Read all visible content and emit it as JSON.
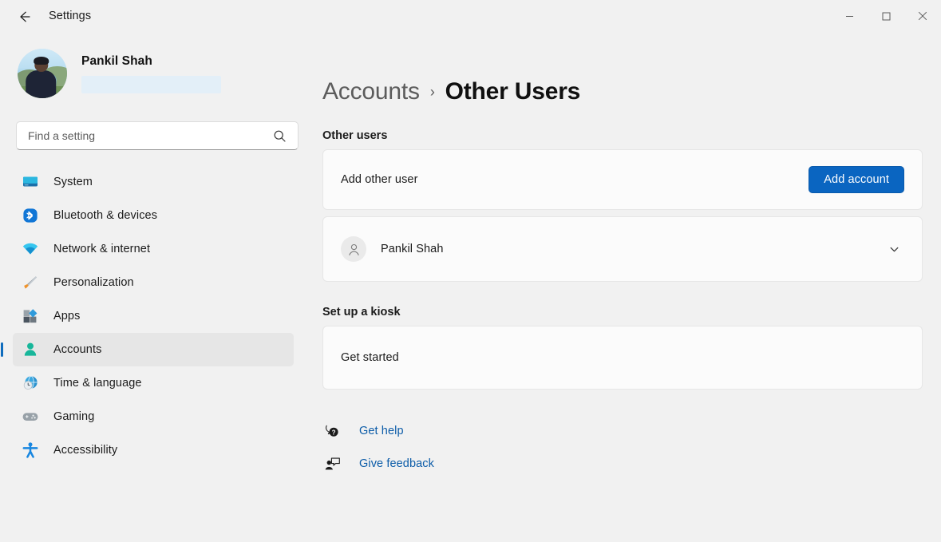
{
  "window": {
    "title": "Settings",
    "back_label": "Back",
    "controls": {
      "minimize": "Minimize",
      "maximize": "Maximize",
      "close": "Close"
    }
  },
  "colors": {
    "accent": "#0a65c1",
    "selection_bar": "#0f6cbd",
    "link": "#0c5ca8",
    "page_background": "#f1f1f1",
    "card_background": "#fbfbfb",
    "redaction": "#e3eff8"
  },
  "sidebar": {
    "profile": {
      "name": "Pankil Shah",
      "avatar_icon": "user-photo-avatar",
      "email_redacted": true
    },
    "search": {
      "placeholder": "Find a setting",
      "value": "",
      "icon": "search-icon"
    },
    "items": [
      {
        "label": "System",
        "icon": "monitor-icon",
        "selected": false
      },
      {
        "label": "Bluetooth & devices",
        "icon": "bluetooth-icon",
        "selected": false
      },
      {
        "label": "Network & internet",
        "icon": "wifi-icon",
        "selected": false
      },
      {
        "label": "Personalization",
        "icon": "paintbrush-icon",
        "selected": false
      },
      {
        "label": "Apps",
        "icon": "apps-grid-icon",
        "selected": false
      },
      {
        "label": "Accounts",
        "icon": "person-icon",
        "selected": true
      },
      {
        "label": "Time & language",
        "icon": "globe-clock-icon",
        "selected": false
      },
      {
        "label": "Gaming",
        "icon": "gamepad-icon",
        "selected": false
      },
      {
        "label": "Accessibility",
        "icon": "accessibility-person-icon",
        "selected": false
      }
    ]
  },
  "main": {
    "breadcrumb": {
      "parent": "Accounts",
      "separator": "›",
      "current": "Other Users"
    },
    "other_users": {
      "section_label": "Other users",
      "add_user": {
        "title": "Add other user",
        "button_label": "Add account"
      },
      "user": {
        "name": "Pankil Shah",
        "avatar_icon": "person-placeholder-icon",
        "expander_icon": "chevron-down-icon"
      }
    },
    "kiosk": {
      "section_label": "Set up a kiosk",
      "row_title": "Get started"
    },
    "links": [
      {
        "label": "Get help",
        "icon": "help-bubble-icon"
      },
      {
        "label": "Give feedback",
        "icon": "feedback-person-icon"
      }
    ]
  }
}
